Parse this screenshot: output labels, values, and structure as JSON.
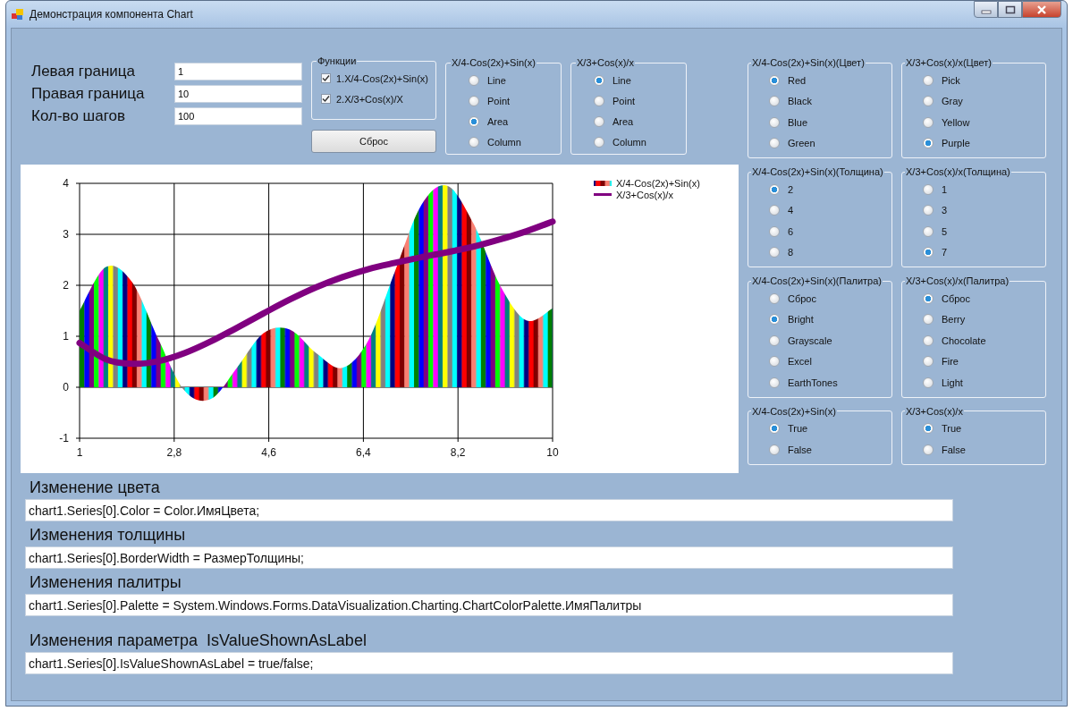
{
  "window": {
    "title": "Демонстрация компонента Chart"
  },
  "range_fields": [
    {
      "label": "Левая граница",
      "value": "1"
    },
    {
      "label": "Правая граница",
      "value": "10"
    },
    {
      "label": "Кол-во шагов",
      "value": "100"
    }
  ],
  "functions_group": {
    "title": "Функции",
    "items": [
      {
        "label": "1.X/4-Cos(2x)+Sin(x)",
        "checked": true
      },
      {
        "label": "2.X/3+Cos(x)/X",
        "checked": true
      }
    ]
  },
  "reset_button": "Сброс",
  "type_groups": [
    {
      "title": "X/4-Cos(2x)+Sin(x)",
      "options": [
        {
          "label": "Line",
          "selected": false
        },
        {
          "label": "Point",
          "selected": false
        },
        {
          "label": "Area",
          "selected": true
        },
        {
          "label": "Column",
          "selected": false
        }
      ]
    },
    {
      "title": "X/3+Cos(x)/x",
      "options": [
        {
          "label": "Line",
          "selected": true
        },
        {
          "label": "Point",
          "selected": false
        },
        {
          "label": "Area",
          "selected": false
        },
        {
          "label": "Column",
          "selected": false
        }
      ]
    }
  ],
  "chart": {
    "chart_data": {
      "type": "area",
      "x": [
        1,
        1.5,
        2,
        2.5,
        3,
        3.5,
        4,
        4.5,
        5,
        5.5,
        6,
        6.5,
        7,
        7.5,
        8,
        8.5,
        9,
        9.5,
        10
      ],
      "series": [
        {
          "name": "X/4-Cos(2x)+Sin(x)",
          "values": [
            1.5,
            2.36,
            2.06,
            0.94,
            -0.07,
            -0.23,
            0.39,
            1.06,
            1.13,
            0.67,
            0.38,
            0.93,
            2.27,
            3.57,
            3.95,
            3.2,
            2.0,
            1.31,
            1.55
          ]
        },
        {
          "name": "X/3+Cos(x)/x",
          "type": "line",
          "color": "#800080",
          "values": [
            0.87,
            0.55,
            0.46,
            0.51,
            0.67,
            0.9,
            1.17,
            1.45,
            1.72,
            1.96,
            2.16,
            2.32,
            2.44,
            2.55,
            2.65,
            2.76,
            2.9,
            3.06,
            3.25
          ]
        }
      ],
      "xlim": [
        1,
        10
      ],
      "ylim": [
        -1,
        4
      ],
      "xticks": [
        1,
        {
          "value": 2.8,
          "label": "2,8"
        },
        {
          "value": 4.6,
          "label": "4,6"
        },
        {
          "value": 6.4,
          "label": "6,4"
        },
        {
          "value": 8.2,
          "label": "8,2"
        },
        10
      ],
      "yticks": [
        -1,
        0,
        1,
        2,
        3,
        4
      ],
      "grid": true,
      "legend": "right"
    }
  },
  "settings_groups": [
    {
      "title": "X/4-Cos(2x)+Sin(x)(Цвет)",
      "options": [
        {
          "label": "Red",
          "selected": true
        },
        {
          "label": "Black",
          "selected": false
        },
        {
          "label": "Blue",
          "selected": false
        },
        {
          "label": "Green",
          "selected": false
        }
      ]
    },
    {
      "title": "X/3+Cos(x)/x(Цвет)",
      "options": [
        {
          "label": "Pick",
          "selected": false
        },
        {
          "label": "Gray",
          "selected": false
        },
        {
          "label": "Yellow",
          "selected": false
        },
        {
          "label": "Purple",
          "selected": true
        }
      ]
    },
    {
      "title": "X/4-Cos(2x)+Sin(x)(Толщина)",
      "options": [
        {
          "label": "2",
          "selected": true
        },
        {
          "label": "4",
          "selected": false
        },
        {
          "label": "6",
          "selected": false
        },
        {
          "label": "8",
          "selected": false
        }
      ]
    },
    {
      "title": "X/3+Cos(x)/x(Толщина)",
      "options": [
        {
          "label": "1",
          "selected": false
        },
        {
          "label": "3",
          "selected": false
        },
        {
          "label": "5",
          "selected": false
        },
        {
          "label": "7",
          "selected": true
        }
      ]
    },
    {
      "title": "X/4-Cos(2x)+Sin(x)(Палитра)",
      "options": [
        {
          "label": "Сброс",
          "selected": false
        },
        {
          "label": "Bright",
          "selected": true
        },
        {
          "label": "Grayscale",
          "selected": false
        },
        {
          "label": "Excel",
          "selected": false
        },
        {
          "label": "EarthTones",
          "selected": false
        }
      ]
    },
    {
      "title": "X/3+Cos(x)/x(Палитра)",
      "options": [
        {
          "label": "Сброс",
          "selected": true
        },
        {
          "label": "Berry",
          "selected": false
        },
        {
          "label": "Chocolate",
          "selected": false
        },
        {
          "label": "Fire",
          "selected": false
        },
        {
          "label": "Light",
          "selected": false
        }
      ]
    },
    {
      "title": "X/4-Cos(2x)+Sin(x)",
      "options": [
        {
          "label": "True",
          "selected": true
        },
        {
          "label": "False",
          "selected": false
        }
      ]
    },
    {
      "title": "X/3+Cos(x)/x",
      "options": [
        {
          "label": "True",
          "selected": true
        },
        {
          "label": "False",
          "selected": false
        }
      ]
    }
  ],
  "code_sections": [
    {
      "heading": "Изменение цвета",
      "code": "chart1.Series[0].Color = Color.ИмяЦвета;"
    },
    {
      "heading": "Изменения толщины",
      "code": "chart1.Series[0].BorderWidth = РазмерТолщины;"
    },
    {
      "heading": "Изменения палитры",
      "code": "chart1.Series[0].Palette = System.Windows.Forms.DataVisualization.Charting.ChartColorPalette.ИмяПалитры"
    },
    {
      "heading": "Изменения параметра  IsValueShownAsLabel",
      "code": "chart1.Series[0].IsValueShownAsLabel = true/false;"
    }
  ]
}
